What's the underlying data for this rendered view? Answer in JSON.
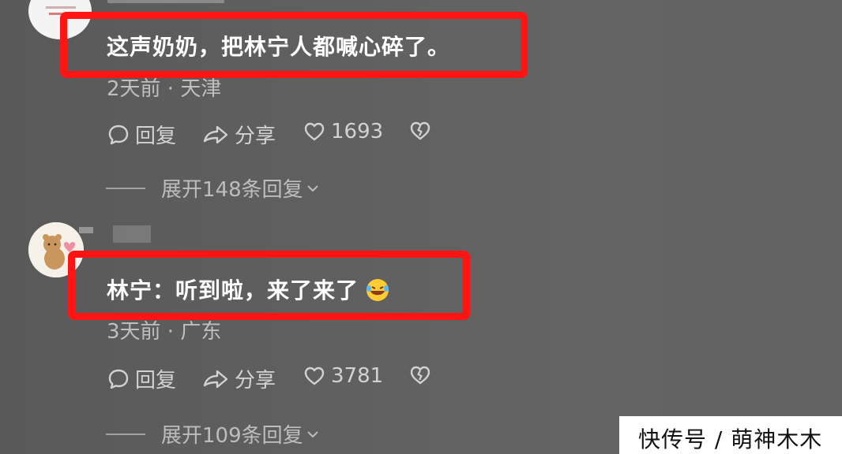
{
  "comments": [
    {
      "text": "这声奶奶，把林宁人都喊心碎了。",
      "meta": "2天前 · 天津",
      "actions": {
        "reply_label": "回复",
        "share_label": "分享",
        "likes": "1693"
      },
      "expand_label": "展开148条回复"
    },
    {
      "text": "林宁：听到啦，来了来了",
      "emoji": "rofl-emoji",
      "meta": "3天前 · 广东",
      "actions": {
        "reply_label": "回复",
        "share_label": "分享",
        "likes": "3781"
      },
      "expand_label": "展开109条回复"
    }
  ],
  "watermark": "快传号 / 萌神木木",
  "colors": {
    "highlight": "#ff1414",
    "background": "#5f5f5f",
    "text": "#ffffff",
    "meta_text": "#bfbfbf"
  },
  "icons": [
    "comment-bubble-icon",
    "share-arrow-icon",
    "heart-icon",
    "broken-heart-icon",
    "chevron-down-icon"
  ]
}
